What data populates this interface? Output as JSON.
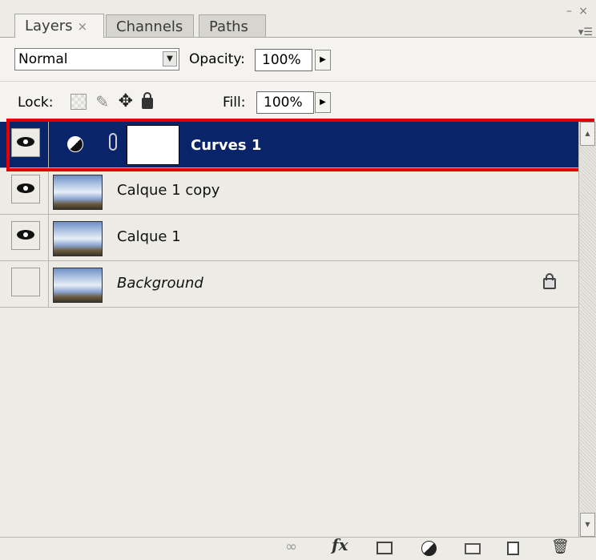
{
  "tabs": [
    {
      "label": "Layers",
      "close": "×",
      "active": true
    },
    {
      "label": "Channels",
      "active": false
    },
    {
      "label": "Paths",
      "active": false
    }
  ],
  "window_controls": "– ×",
  "panel_menu_icon": "flyout-menu-icon",
  "blend_mode": {
    "value": "Normal"
  },
  "opacity": {
    "label": "Opacity:",
    "value": "100%"
  },
  "lock": {
    "label": "Lock:"
  },
  "fill": {
    "label": "Fill:",
    "value": "100%"
  },
  "layers": [
    {
      "name": "Curves 1",
      "visible": true,
      "selected": true,
      "type": "adjustment"
    },
    {
      "name": "Calque 1 copy",
      "visible": true,
      "selected": false
    },
    {
      "name": "Calque 1",
      "visible": true,
      "selected": false
    },
    {
      "name": "Background",
      "visible": false,
      "selected": false,
      "locked": true
    }
  ],
  "bottom_icons": [
    "link-layers-icon",
    "fx-icon",
    "add-mask-icon",
    "adjustment-layer-icon",
    "new-group-icon",
    "new-layer-icon",
    "delete-icon"
  ],
  "bottom_fx_label": "fx",
  "colors": {
    "selection": "#0a246a",
    "highlight_outline": "#e30000"
  }
}
